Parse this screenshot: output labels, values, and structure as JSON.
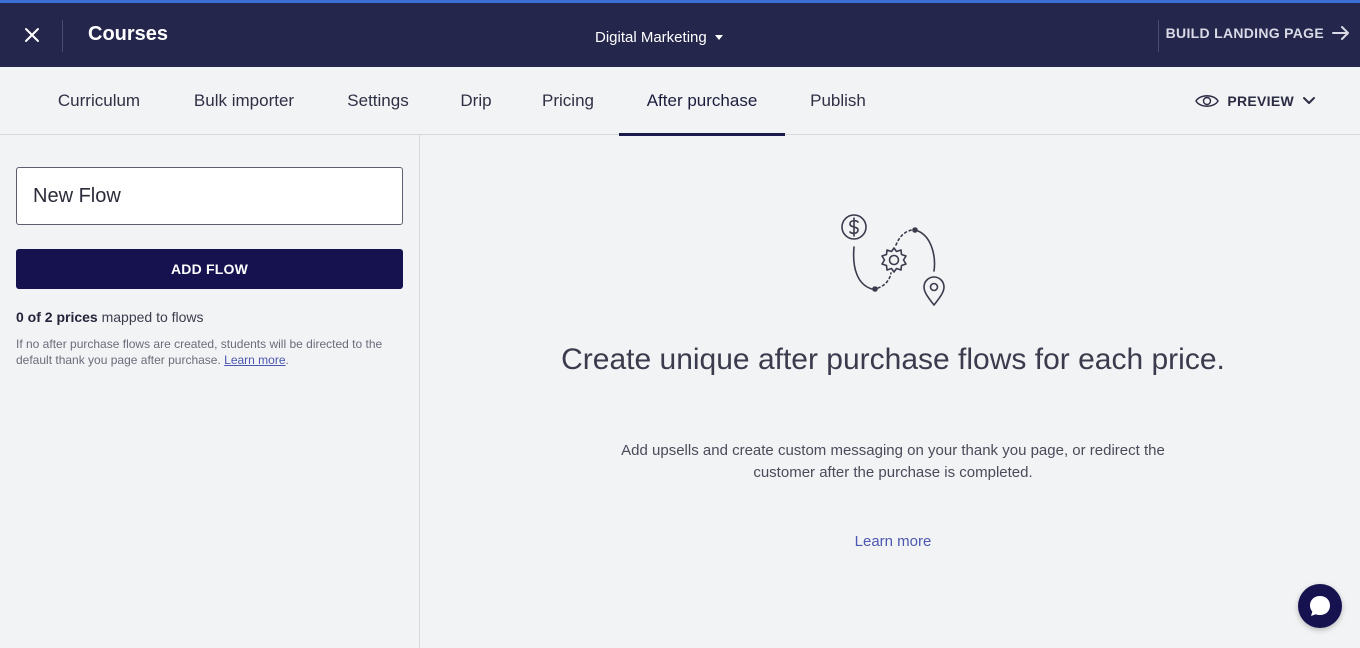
{
  "header": {
    "title": "Courses",
    "course_name": "Digital Marketing",
    "build_label": "BUILD LANDING PAGE"
  },
  "tabs": [
    {
      "label": "Curriculum"
    },
    {
      "label": "Bulk importer"
    },
    {
      "label": "Settings"
    },
    {
      "label": "Drip"
    },
    {
      "label": "Pricing"
    },
    {
      "label": "After purchase",
      "active": true
    },
    {
      "label": "Publish"
    }
  ],
  "preview": {
    "label": "PREVIEW"
  },
  "sidebar": {
    "flow_input_value": "New Flow",
    "add_flow_label": "ADD FLOW",
    "mapped_count": "0 of 2 prices",
    "mapped_suffix": " mapped to flows",
    "hint_text": "If no after purchase flows are created, students will be directed to the default thank you page after purchase. ",
    "hint_link": "Learn more",
    "hint_end": "."
  },
  "main": {
    "headline": "Create unique after purchase flows for each price.",
    "subtext": "Add upsells and create custom messaging on your thank you page, or redirect the customer after the purchase is completed.",
    "learn_more": "Learn more"
  },
  "colors": {
    "header_bg": "#25264c",
    "primary_button": "#15124f",
    "link": "#4d58b0",
    "page_bg": "#f2f3f5"
  },
  "icons": [
    "close-icon",
    "caret-down-icon",
    "arrow-right-icon",
    "eye-icon",
    "chevron-down-icon",
    "dollar-coin-icon",
    "gear-icon",
    "location-pin-icon",
    "chat-icon"
  ]
}
